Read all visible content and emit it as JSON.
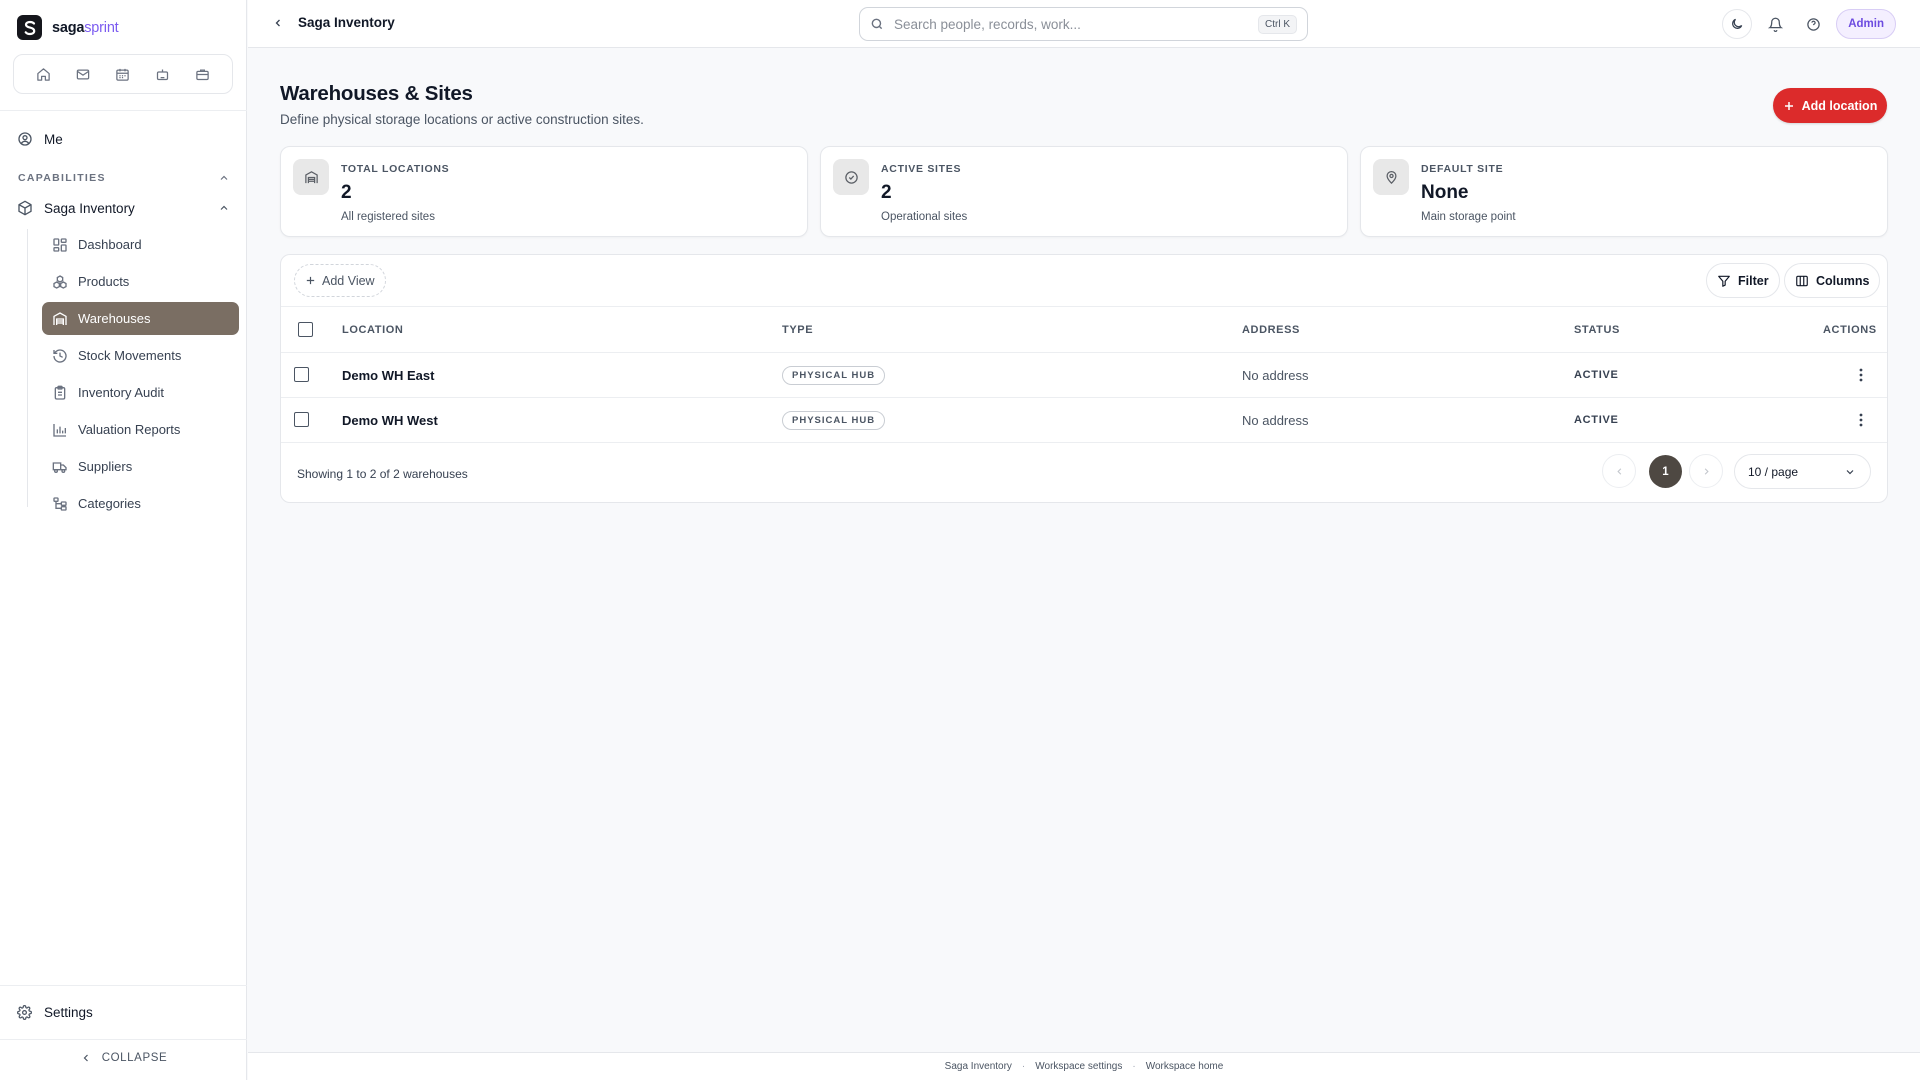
{
  "brand": {
    "name_primary": "saga",
    "name_accent": "sprint"
  },
  "quick_nav": [
    "home-icon",
    "mail-icon",
    "calendar-icon",
    "bot-icon",
    "briefcase-icon"
  ],
  "sidebar": {
    "me_label": "Me",
    "section_label": "CAPABILITIES",
    "module_label": "Saga Inventory",
    "items": [
      {
        "label": "Dashboard",
        "icon": "dashboard-icon",
        "active": false
      },
      {
        "label": "Products",
        "icon": "products-icon",
        "active": false
      },
      {
        "label": "Warehouses",
        "icon": "warehouse-icon",
        "active": true
      },
      {
        "label": "Stock Movements",
        "icon": "history-icon",
        "active": false
      },
      {
        "label": "Inventory Audit",
        "icon": "clipboard-icon",
        "active": false
      },
      {
        "label": "Valuation Reports",
        "icon": "bar-chart-icon",
        "active": false
      },
      {
        "label": "Suppliers",
        "icon": "truck-icon",
        "active": false
      },
      {
        "label": "Categories",
        "icon": "tree-icon",
        "active": false
      }
    ],
    "settings_label": "Settings",
    "collapse_label": "COLLAPSE"
  },
  "topbar": {
    "breadcrumb": "Saga Inventory",
    "search_placeholder": "Search people, records, work...",
    "search_shortcut": "Ctrl K",
    "admin_label": "Admin"
  },
  "page": {
    "title": "Warehouses & Sites",
    "subtitle": "Define physical storage locations or active construction sites.",
    "add_button": "Add location"
  },
  "stats": [
    {
      "label": "TOTAL LOCATIONS",
      "value": "2",
      "note": "All registered sites",
      "icon": "building-icon"
    },
    {
      "label": "ACTIVE SITES",
      "value": "2",
      "note": "Operational sites",
      "icon": "check-circle-icon"
    },
    {
      "label": "DEFAULT SITE",
      "value": "None",
      "note": "Main storage point",
      "icon": "map-pin-icon"
    }
  ],
  "table": {
    "add_view": "Add View",
    "filter": "Filter",
    "columns_button": "Columns",
    "headers": {
      "location": "LOCATION",
      "type": "TYPE",
      "address": "ADDRESS",
      "status": "STATUS",
      "actions": "ACTIONS"
    },
    "rows": [
      {
        "location": "Demo WH East",
        "type": "PHYSICAL HUB",
        "address": "No address",
        "status": "ACTIVE"
      },
      {
        "location": "Demo WH West",
        "type": "PHYSICAL HUB",
        "address": "No address",
        "status": "ACTIVE"
      }
    ],
    "showing": "Showing 1 to 2 of 2 warehouses",
    "current_page": "1",
    "page_size": "10 / page"
  },
  "footer": {
    "links": [
      "Saga Inventory",
      "Workspace settings",
      "Workspace home"
    ]
  },
  "colors": {
    "accent": "#dc2b2b",
    "active_nav": "#7a6e63",
    "brand_accent": "#7c5cf0",
    "admin": "#6d4ce0"
  }
}
